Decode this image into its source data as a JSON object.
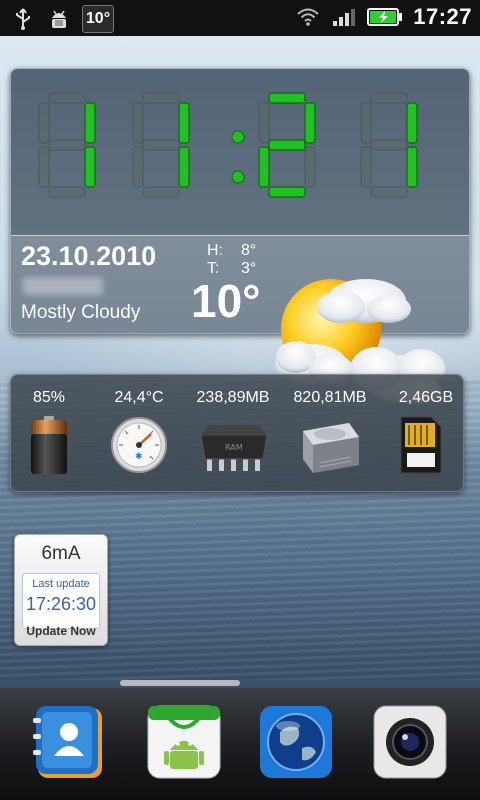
{
  "status_bar": {
    "temp_badge": "10°",
    "time": "17:27",
    "icons": [
      "usb-icon",
      "android-debug-icon",
      "wifi-icon",
      "signal-icon",
      "battery-charging-icon"
    ]
  },
  "clock_widget": {
    "time_digits": [
      "1",
      "1",
      "2",
      "1"
    ],
    "date": "23.10.2010",
    "condition": "Mostly Cloudy",
    "high_label": "H:",
    "high_value": "8°",
    "low_label": "T:",
    "low_value": "3°",
    "current_temp": "10°",
    "weather_icon": "partly-cloudy-icon",
    "digit_color": "#22c022"
  },
  "system_widget": {
    "items": [
      {
        "value": "85%",
        "icon": "battery-icon"
      },
      {
        "value": "24,4°C",
        "icon": "thermometer-gauge-icon"
      },
      {
        "value": "238,89MB",
        "icon": "ram-chip-icon"
      },
      {
        "value": "820,81MB",
        "icon": "hard-disk-icon"
      },
      {
        "value": "2,46GB",
        "icon": "sd-card-icon"
      }
    ]
  },
  "current_widget": {
    "value": "6mA",
    "last_update_label": "Last update",
    "last_update_time": "17:26:30",
    "button_label": "Update Now"
  },
  "dock": {
    "items": [
      {
        "name": "contacts",
        "icon": "contacts-icon"
      },
      {
        "name": "market",
        "icon": "android-market-icon"
      },
      {
        "name": "browser",
        "icon": "globe-icon"
      },
      {
        "name": "camera",
        "icon": "camera-icon"
      }
    ]
  }
}
